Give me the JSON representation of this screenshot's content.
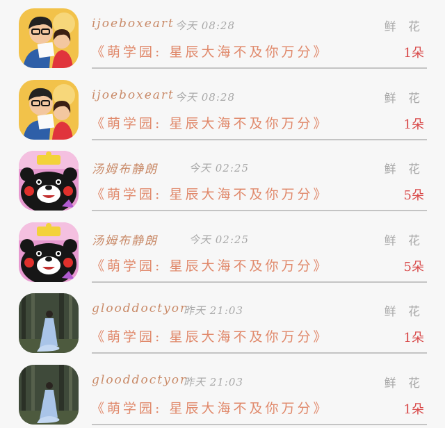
{
  "records": [
    {
      "name": "ijoeboxeart",
      "time": "今天 08:28",
      "kind": "鲜 花",
      "desc": "《萌学园: 星辰大海不及你万分》",
      "count": "1朵",
      "avatar": "cartoon-father-daughter-avatar"
    },
    {
      "name": "ijoeboxeart",
      "time": "今天 08:28",
      "kind": "鲜 花",
      "desc": "《萌学园: 星辰大海不及你万分》",
      "count": "1朵",
      "avatar": "cartoon-father-daughter-avatar"
    },
    {
      "name": "汤姆布静朗",
      "time": "今天 02:25",
      "kind": "鲜 花",
      "desc": "《萌学园: 星辰大海不及你万分》",
      "count": "5朵",
      "avatar": "black-bear-mascot-avatar"
    },
    {
      "name": "汤姆布静朗",
      "time": "今天 02:25",
      "kind": "鲜 花",
      "desc": "《萌学园: 星辰大海不及你万分》",
      "count": "5朵",
      "avatar": "black-bear-mascot-avatar"
    },
    {
      "name": "glooddoctyor",
      "time": "昨天 21:03",
      "kind": "鲜 花",
      "desc": "《萌学园: 星辰大海不及你万分》",
      "count": "1朵",
      "avatar": "forest-woman-photo-avatar"
    },
    {
      "name": "glooddoctyor",
      "time": "昨天 21:03",
      "kind": "鲜 花",
      "desc": "《萌学园: 星辰大海不及你万分》",
      "count": "1朵",
      "avatar": "forest-woman-photo-avatar"
    }
  ],
  "colors": {
    "name": "#c98a68",
    "desc": "#e0886a",
    "count": "#d84848",
    "muted": "#a8a8a8",
    "divider": "#c4c4c4"
  }
}
